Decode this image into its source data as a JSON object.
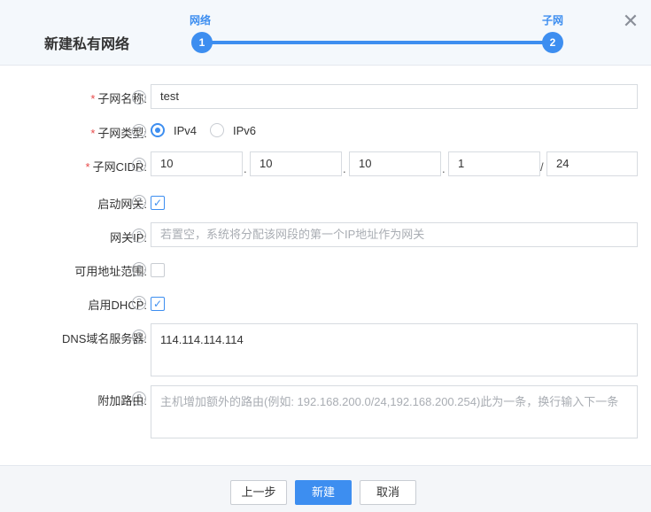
{
  "dialog": {
    "title": "新建私有网络",
    "close_glyph": "✕",
    "steps": [
      {
        "number": "1",
        "label": "网络"
      },
      {
        "number": "2",
        "label": "子网"
      }
    ],
    "accent_color": "#3d8ef0"
  },
  "form": {
    "help_glyph": "?",
    "required_mark": "*",
    "subnet_name": {
      "label": "子网名称:",
      "value": "test"
    },
    "subnet_type": {
      "label": "子网类型:",
      "options": [
        "IPv4",
        "IPv6"
      ],
      "selected": "IPv4"
    },
    "subnet_cidr": {
      "label": "子网CIDR:",
      "octets": [
        "10",
        "10",
        "10",
        "1"
      ],
      "prefix": "24",
      "dot": ".",
      "slash": "/"
    },
    "enable_gateway": {
      "label": "启动网关:",
      "checked": true
    },
    "gateway_ip": {
      "label": "网关IP:",
      "placeholder": "若置空，系统将分配该网段的第一个IP地址作为网关"
    },
    "address_range": {
      "label": "可用地址范围:",
      "checked": false
    },
    "enable_dhcp": {
      "label": "启用DHCP:",
      "checked": true
    },
    "dns": {
      "label": "DNS域名服务器:",
      "value": "114.114.114.114"
    },
    "extra_routes": {
      "label": "附加路由:",
      "placeholder": "主机增加额外的路由(例如: 192.168.200.0/24,192.168.200.254)此为一条，换行输入下一条"
    }
  },
  "footer": {
    "prev_label": "上一步",
    "create_label": "新建",
    "cancel_label": "取消"
  }
}
